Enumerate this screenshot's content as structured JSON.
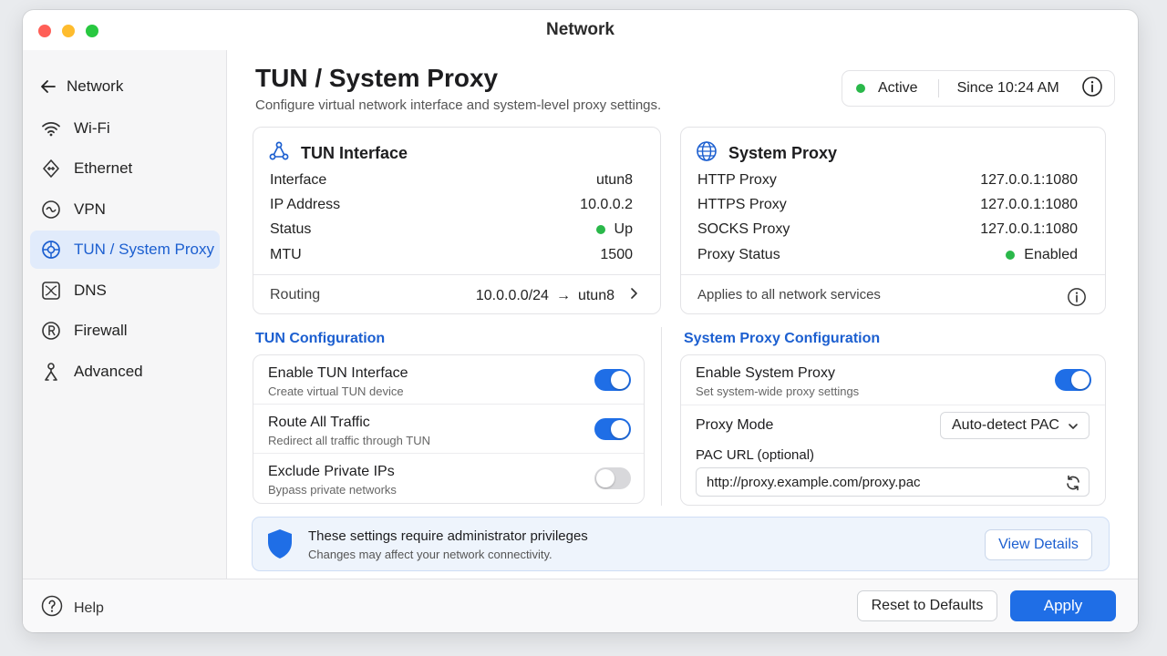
{
  "window": {
    "title": "Network"
  },
  "colors": {
    "accent": "#1f6ee6",
    "status_green": "#2ab84a",
    "toggle_off": "#d8d8db"
  },
  "sidebar": {
    "back_label": "Network",
    "items": [
      {
        "label": "Wi-Fi",
        "icon": "wifi-icon"
      },
      {
        "label": "Ethernet",
        "icon": "ethernet-icon"
      },
      {
        "label": "VPN",
        "icon": "vpn-icon"
      },
      {
        "label": "TUN / System Proxy",
        "icon": "tun-proxy-icon",
        "active": true
      },
      {
        "label": "DNS",
        "icon": "dns-icon"
      },
      {
        "label": "Firewall",
        "icon": "firewall-icon"
      },
      {
        "label": "Advanced",
        "icon": "advanced-icon"
      }
    ]
  },
  "header": {
    "title": "TUN / System Proxy",
    "subtitle": "Configure virtual network interface and system-level proxy settings.",
    "status": "Active",
    "since": "Since 10:24 AM"
  },
  "tun_card": {
    "title": "TUN Interface",
    "rows": [
      {
        "label": "Interface",
        "value": "utun8"
      },
      {
        "label": "IP Address",
        "value": "10.0.0.2"
      },
      {
        "label": "Status",
        "value": "Up"
      },
      {
        "label": "MTU",
        "value": "1500"
      }
    ],
    "routing_label": "Routing",
    "routing_from": "10.0.0.0/24",
    "routing_arrow": "→",
    "routing_to": "utun8"
  },
  "proxy_card": {
    "title": "System Proxy",
    "rows": [
      {
        "label": "HTTP Proxy",
        "value": "127.0.0.1:1080"
      },
      {
        "label": "HTTPS Proxy",
        "value": "127.0.0.1:1080"
      },
      {
        "label": "SOCKS Proxy",
        "value": "127.0.0.1:1080"
      },
      {
        "label": "Proxy Status",
        "value": "Enabled"
      }
    ],
    "footer_note": "Applies to all network services"
  },
  "tun_config": {
    "section_title": "TUN Configuration",
    "rows": [
      {
        "title": "Enable TUN Interface",
        "subtitle": "Create virtual TUN device",
        "enabled": true
      },
      {
        "title": "Route All Traffic",
        "subtitle": "Redirect all traffic through TUN",
        "enabled": true
      },
      {
        "title": "Exclude Private IPs",
        "subtitle": "Bypass private networks",
        "enabled": false
      }
    ]
  },
  "proxy_config": {
    "section_title": "System Proxy Configuration",
    "enable_title": "Enable System Proxy",
    "enable_subtitle": "Set system-wide proxy settings",
    "enabled": true,
    "mode_label": "Proxy Mode",
    "mode_value": "Auto-detect PAC",
    "pac_label": "PAC URL (optional)",
    "pac_value": "http://proxy.example.com/proxy.pac"
  },
  "banner": {
    "title": "These settings require administrator privileges",
    "subtitle": "Changes may affect your network connectivity.",
    "button": "View Details"
  },
  "footer": {
    "help": "Help",
    "reset": "Reset to Defaults",
    "apply": "Apply"
  }
}
